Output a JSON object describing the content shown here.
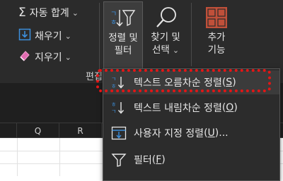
{
  "ribbon": {
    "autosum": {
      "icon": "sigma-icon",
      "label": "자동 합계"
    },
    "fill": {
      "icon": "fill-down-icon",
      "label": "채우기"
    },
    "clear": {
      "icon": "eraser-icon",
      "label": "지우기"
    },
    "sort_filter": {
      "icon": "sort-filter-icon",
      "line1": "정렬 및",
      "line2": "필터"
    },
    "find_select": {
      "icon": "magnifier-icon",
      "line1": "찾기 및",
      "line2": "선택"
    },
    "addins": {
      "icon": "addins-grid-icon",
      "line1": "추가",
      "line2": "기능"
    },
    "group_label": "편집",
    "chevron": "⌄"
  },
  "sheet": {
    "columns": [
      "Q",
      "R"
    ]
  },
  "menu": {
    "items": [
      {
        "icon": "sort-az-icon",
        "label": "텍스트 오름차순 정렬",
        "key": "S"
      },
      {
        "icon": "sort-za-icon",
        "label": "텍스트 내림차순 정렬",
        "key": "O"
      },
      {
        "icon": "custom-sort-icon",
        "label": "사용자 지정 정렬",
        "key": "U",
        "suffix": "..."
      },
      {
        "icon": "funnel-icon",
        "label": "필터",
        "key": "F"
      }
    ]
  },
  "colors": {
    "ribbon_bg": "#2b2b2b",
    "menu_bg": "#2c2c2c",
    "highlight": "#e21616",
    "accent_blue": "#3c8fdc",
    "addins_orange": "#c0503a"
  }
}
